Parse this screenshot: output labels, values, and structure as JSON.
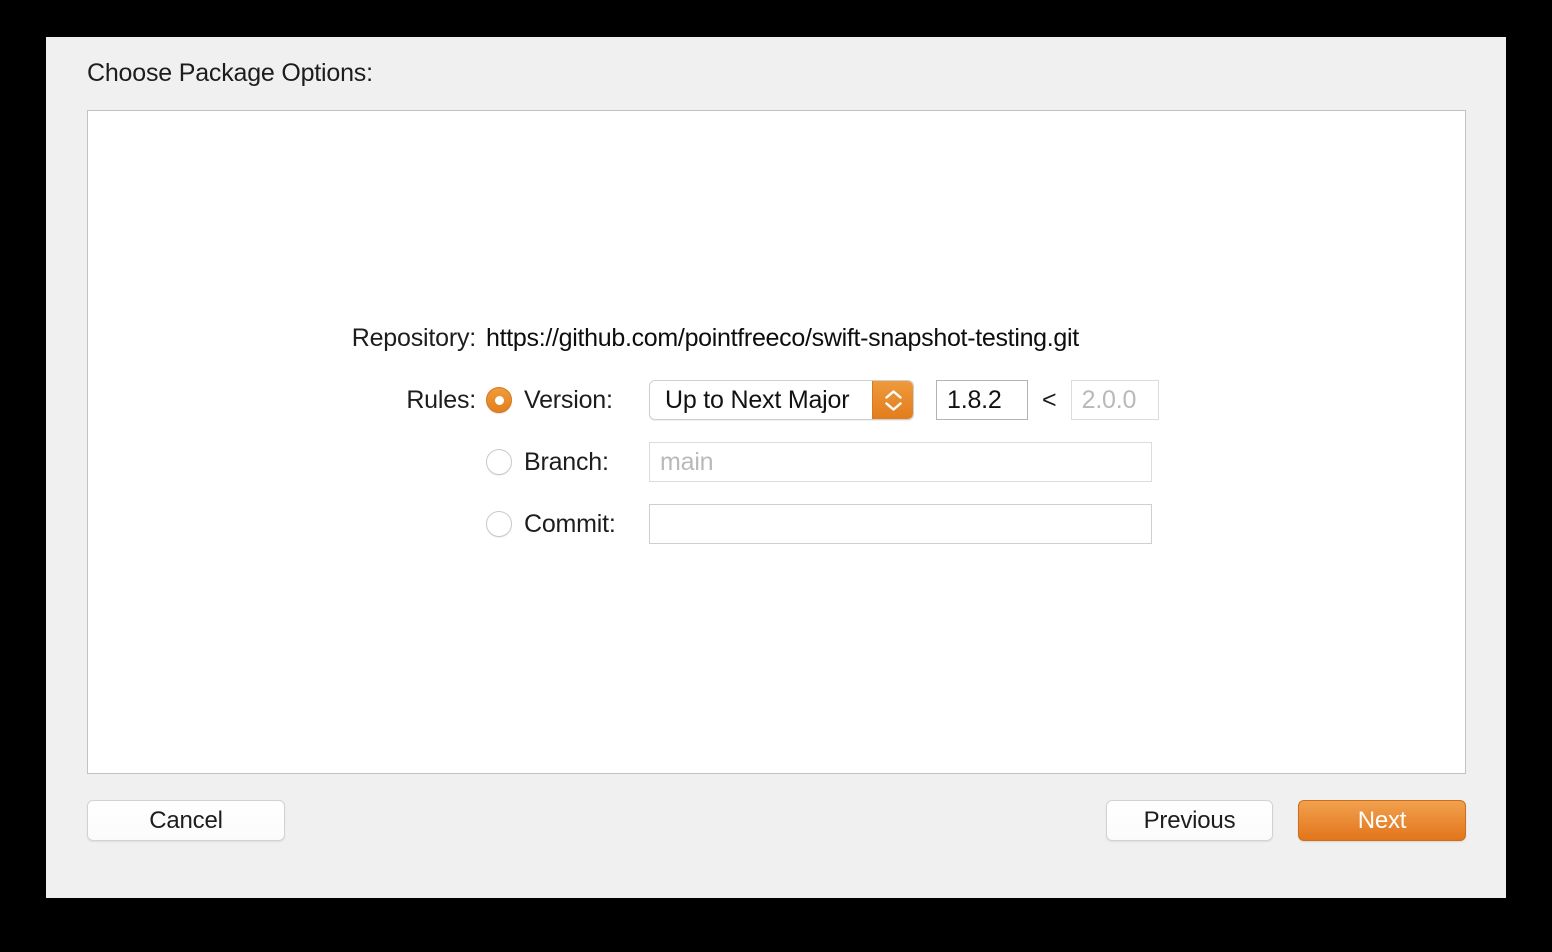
{
  "dialog": {
    "title": "Choose Package Options:"
  },
  "form": {
    "repository": {
      "label": "Repository:",
      "value": "https://github.com/pointfreeco/swift-snapshot-testing.git"
    },
    "rules": {
      "label": "Rules:",
      "options": [
        {
          "id": "version",
          "caption": "Version:",
          "selected": true,
          "rule_select": {
            "value": "Up to Next Major",
            "stepper_icon": "stepper-up-down-icon"
          },
          "lower_bound": {
            "value": "1.8.2",
            "placeholder": ""
          },
          "operator": "<",
          "upper_bound": {
            "value": "",
            "placeholder": "2.0.0"
          }
        },
        {
          "id": "branch",
          "caption": "Branch:",
          "selected": false,
          "field": {
            "value": "",
            "placeholder": "main"
          }
        },
        {
          "id": "commit",
          "caption": "Commit:",
          "selected": false,
          "field": {
            "value": "",
            "placeholder": ""
          }
        }
      ]
    }
  },
  "footer": {
    "cancel_label": "Cancel",
    "previous_label": "Previous",
    "next_label": "Next"
  },
  "colors": {
    "accent": "#e2801f",
    "accent_light": "#ef9b3c",
    "dialog_background": "#f0f0f0",
    "panel_background": "#ffffff",
    "panel_border": "#c2c2c2",
    "text": "#1d1d1f",
    "placeholder": "#b9b9b9"
  }
}
